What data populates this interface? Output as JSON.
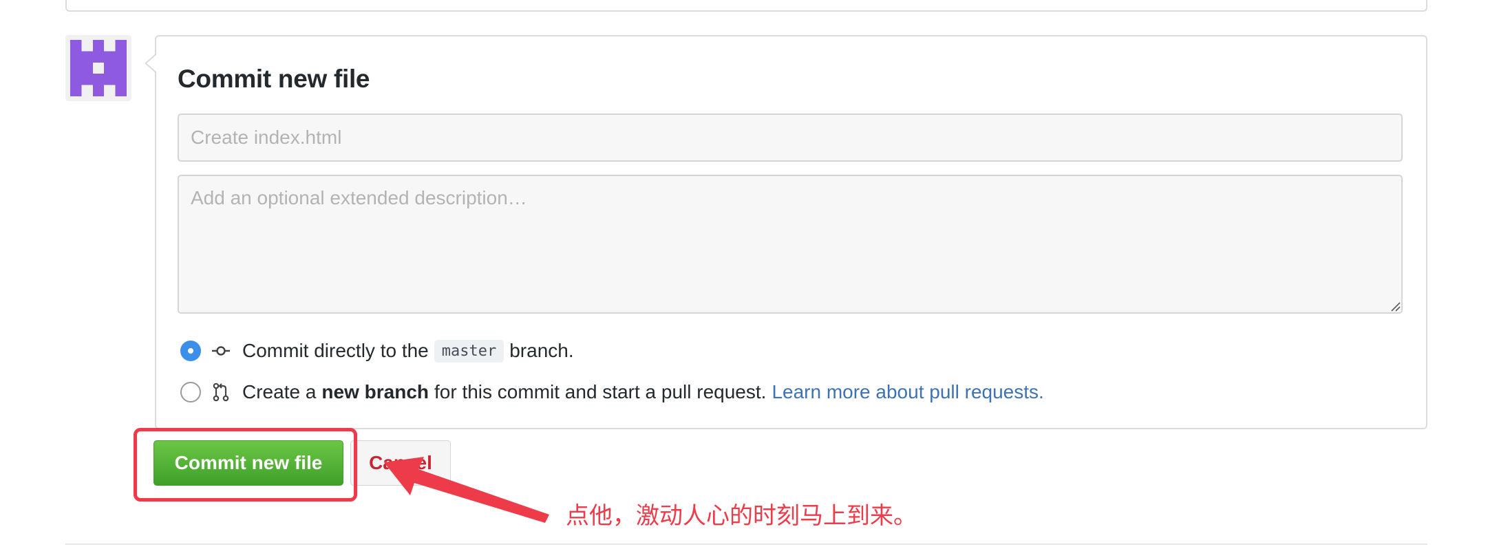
{
  "commit_form": {
    "title": "Commit new file",
    "summary_placeholder": "Create index.html",
    "description_placeholder": "Add an optional extended description…",
    "option_direct": {
      "prefix": "Commit directly to the",
      "branch": "master",
      "suffix": "branch.",
      "selected": true
    },
    "option_new_branch": {
      "prefix": "Create a",
      "bold": "new branch",
      "middle": "for this commit and start a pull request.",
      "link": "Learn more about pull requests.",
      "selected": false
    },
    "commit_button": "Commit new file",
    "cancel_button": "Cancel"
  },
  "annotation": {
    "text": "点他，激动人心的时刻马上到来。",
    "color": "#ee3b49"
  },
  "colors": {
    "commit_green": "#4cae31",
    "link_blue": "#3d72b4",
    "radio_blue": "#3c8fe8",
    "avatar_purple": "#8e5ae0"
  },
  "icons": {
    "avatar": "identicon-avatar",
    "direct_commit": "git-commit-icon",
    "new_branch": "git-pull-request-icon"
  }
}
